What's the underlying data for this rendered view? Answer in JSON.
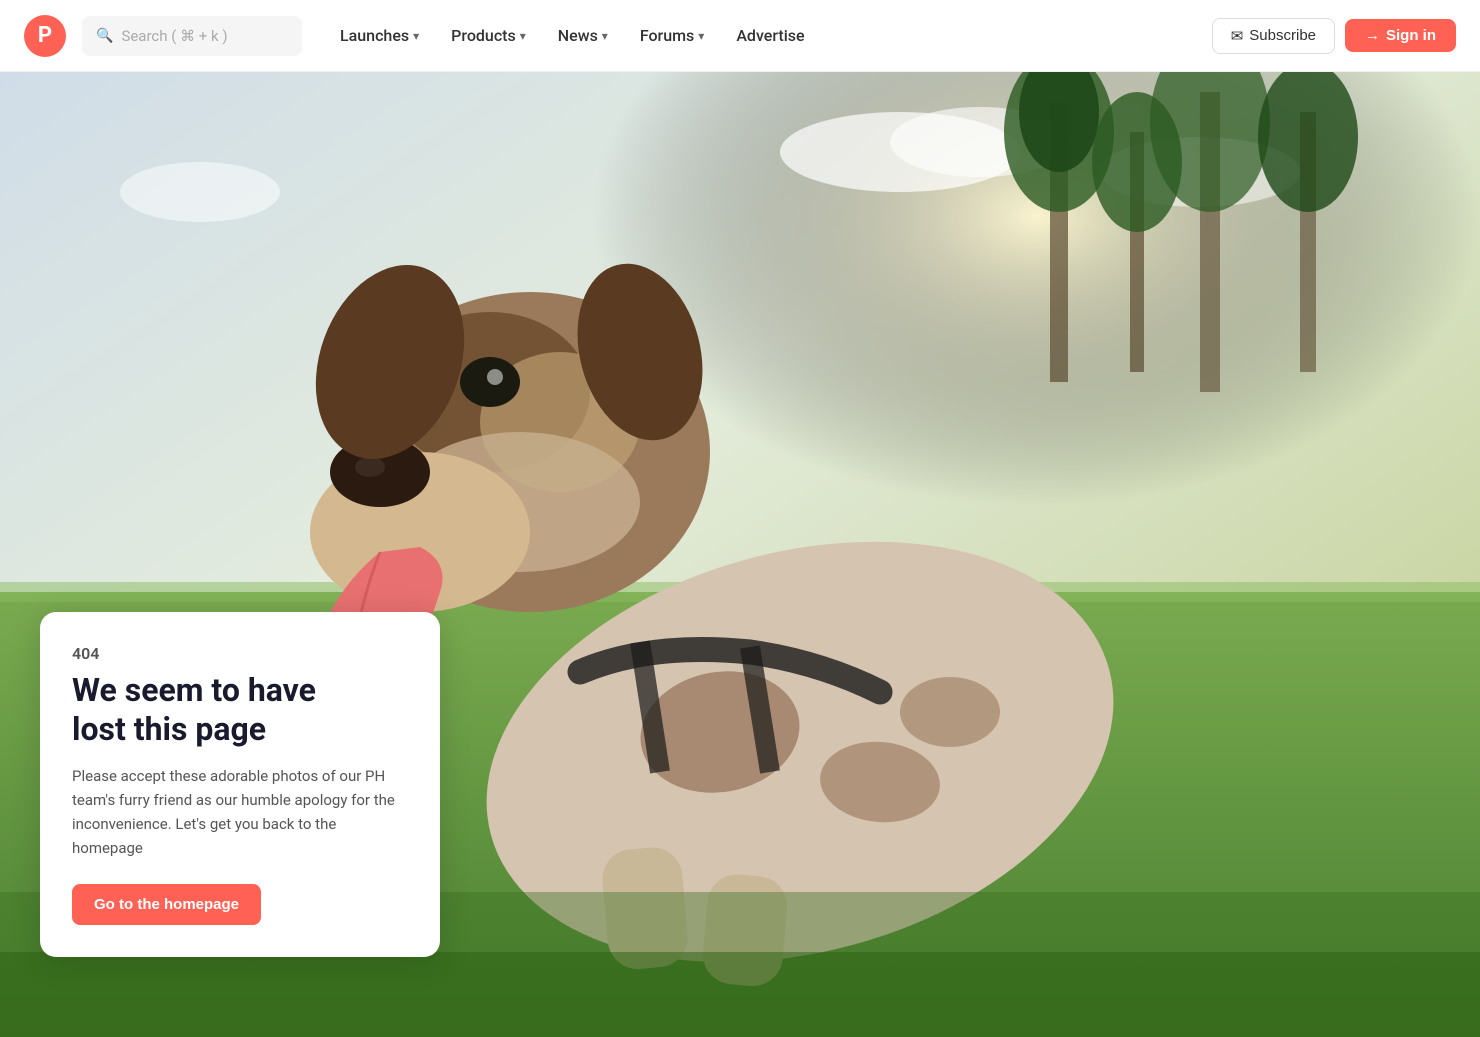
{
  "logo": {
    "letter": "P",
    "color": "#ff6154"
  },
  "search": {
    "placeholder": "Search ( ⌘ + k )"
  },
  "nav": {
    "items": [
      {
        "label": "Launches",
        "has_dropdown": true
      },
      {
        "label": "Products",
        "has_dropdown": true
      },
      {
        "label": "News",
        "has_dropdown": true
      },
      {
        "label": "Forums",
        "has_dropdown": true
      },
      {
        "label": "Advertise",
        "has_dropdown": false
      }
    ],
    "subscribe_label": "Subscribe",
    "signin_label": "Sign in"
  },
  "error": {
    "code": "404",
    "title_line1": "We seem to have",
    "title_line2": "lost this page",
    "description": "Please accept these adorable photos of our PH team's furry friend as our humble apology for the inconvenience. Let's get you back to the homepage",
    "cta_label": "Go to the homepage"
  }
}
